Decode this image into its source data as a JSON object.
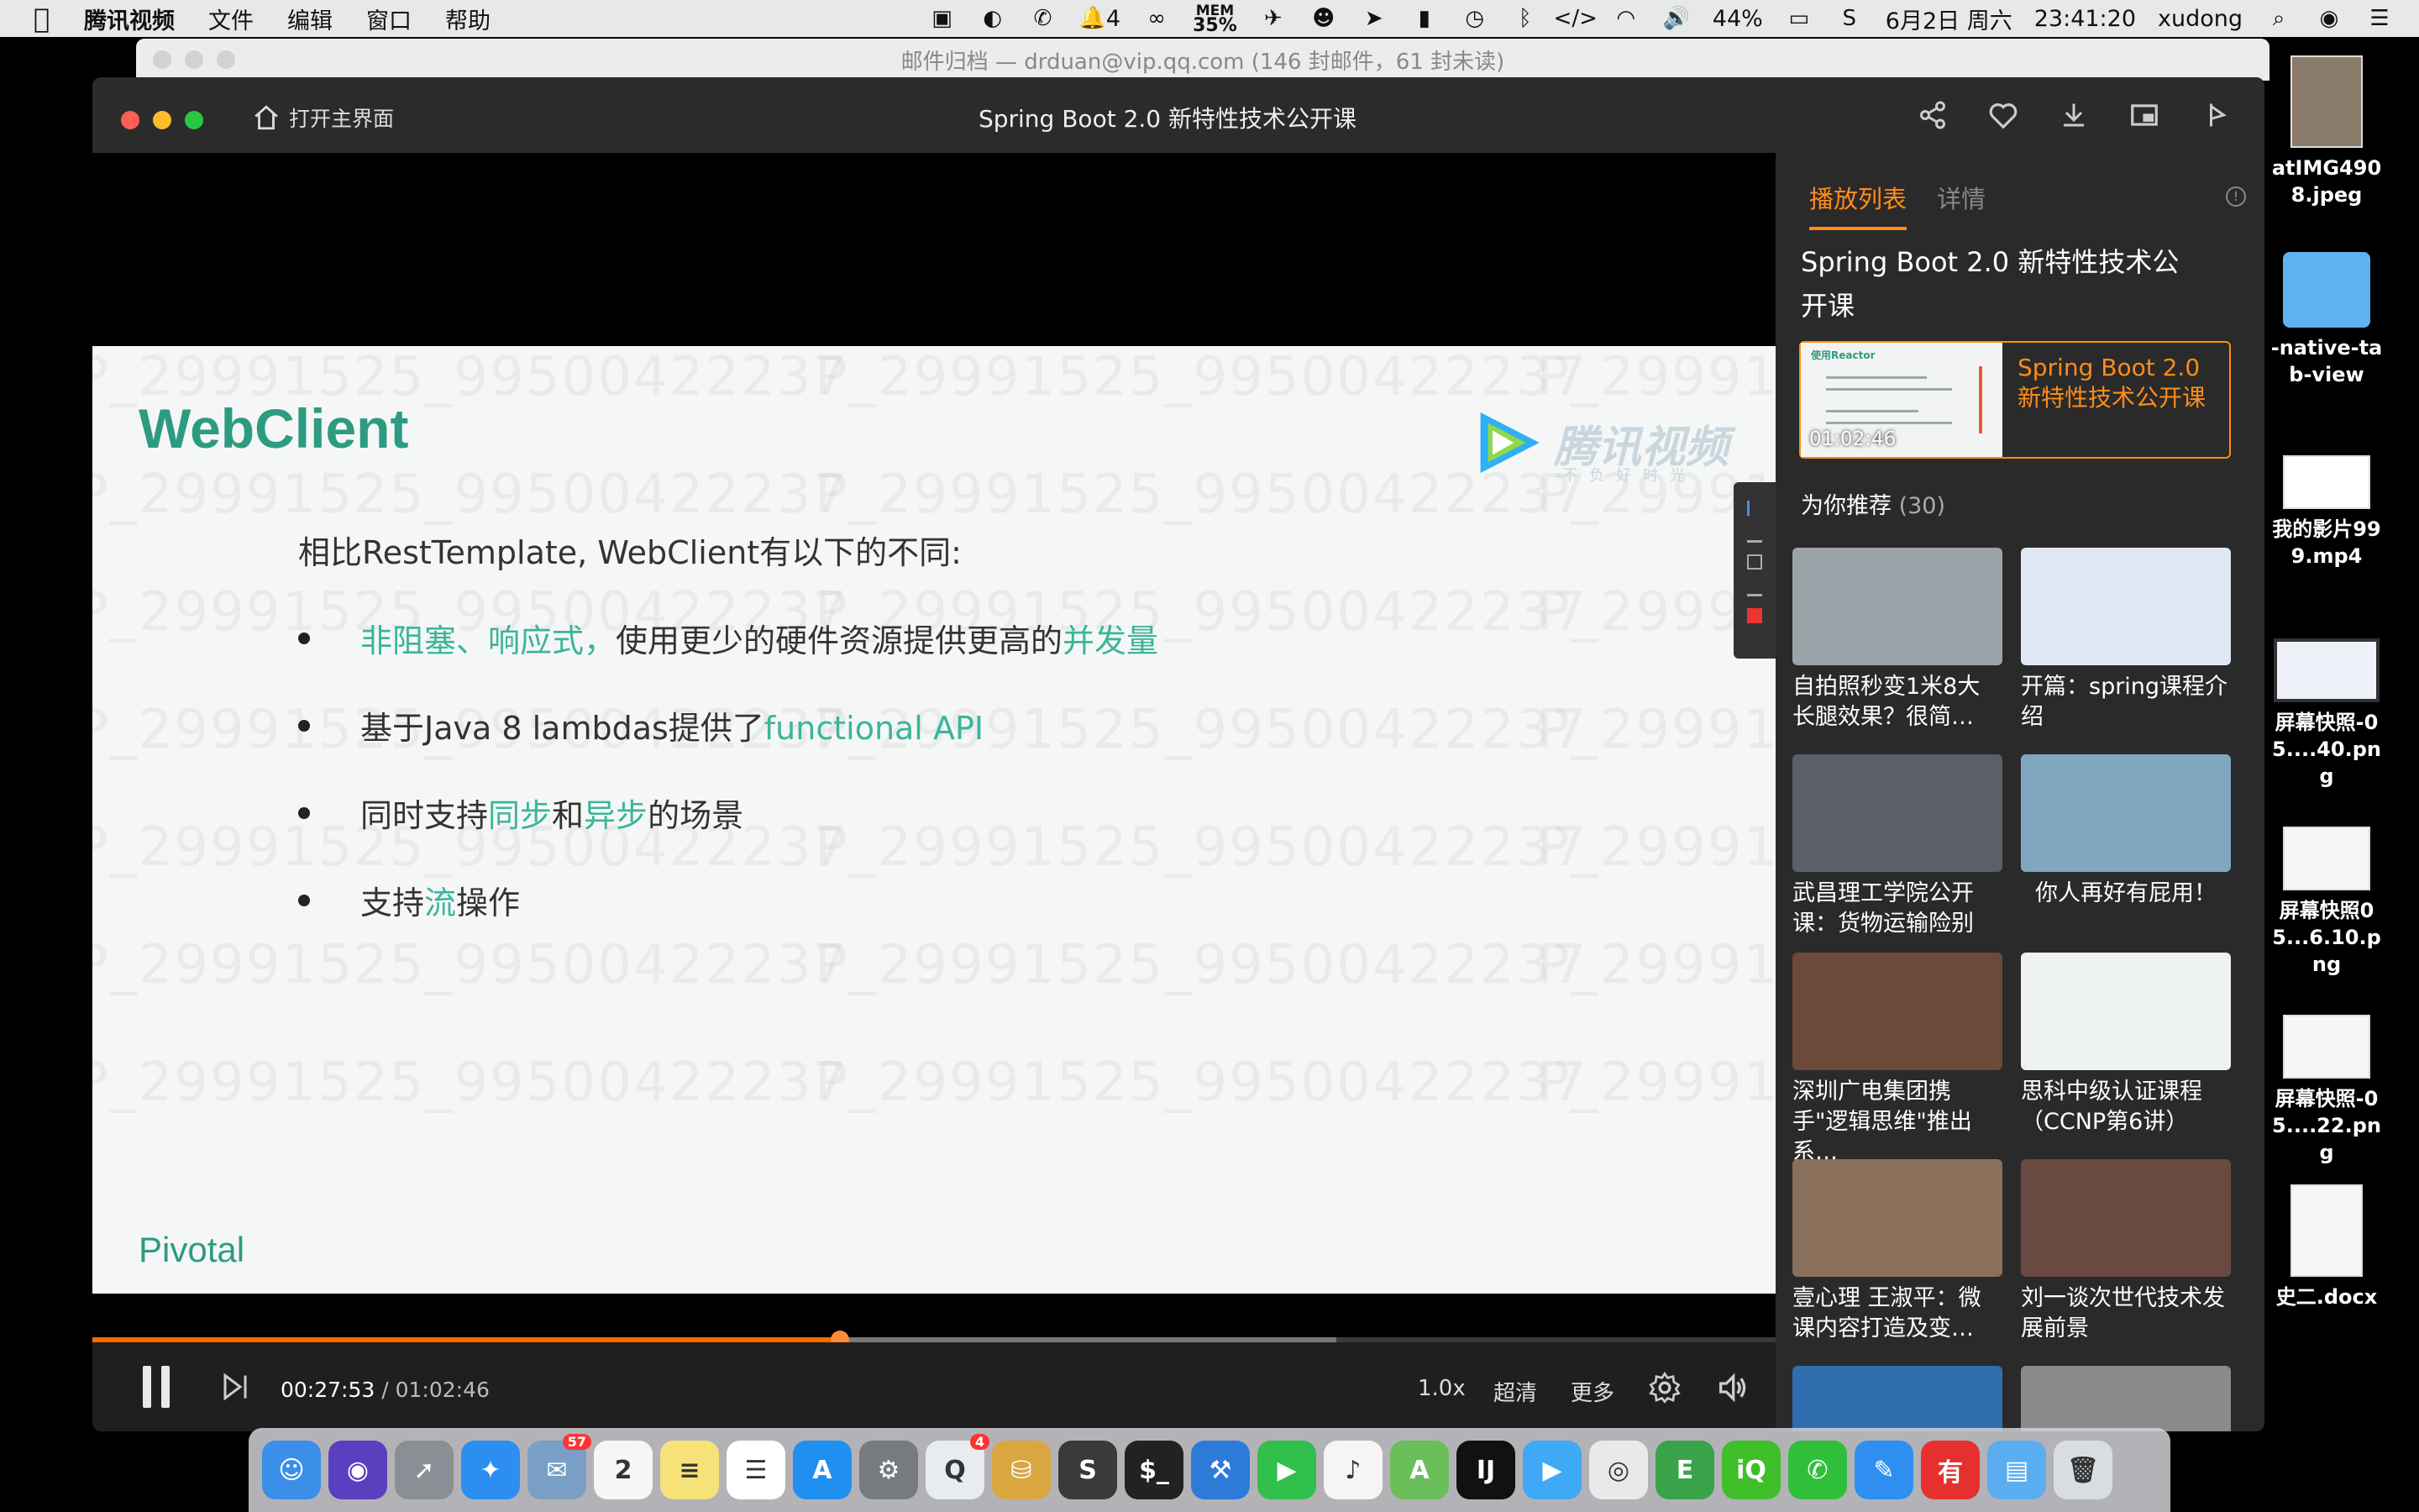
{
  "menubar": {
    "app_name": "腾讯视频",
    "menus": [
      "文件",
      "编辑",
      "窗口",
      "帮助"
    ],
    "notification_count": "4",
    "mem_label": "MEM",
    "mem_value": "35%",
    "battery": "44%",
    "date": "6月2日 周六",
    "time": "23:41:20",
    "user": "xudong"
  },
  "mail_window": {
    "title": "邮件归档 — drduan@vip.qq.com (146 封邮件，61 封未读)"
  },
  "player": {
    "home_label": "打开主界面",
    "title": "Spring Boot 2.0 新特性技术公开课",
    "toolbar_icons": [
      "share-icon",
      "favorite-icon",
      "download-icon",
      "miniplayer-icon",
      "pin-icon"
    ]
  },
  "slide": {
    "title": "WebClient",
    "subtitle": "相比RestTemplate, WebClient有以下的不同:",
    "watermark": "P_29991525_99500422237",
    "bullets": [
      {
        "parts": [
          {
            "t": "非阻塞、响应式，",
            "hl": true
          },
          {
            "t": "使用更少的硬件资源提供更高的",
            "hl": false
          },
          {
            "t": "并发量",
            "hl": true
          }
        ]
      },
      {
        "parts": [
          {
            "t": "基于Java 8 lambdas提供了",
            "hl": false
          },
          {
            "t": "functional API",
            "hl": true
          }
        ]
      },
      {
        "parts": [
          {
            "t": "同时支持",
            "hl": false
          },
          {
            "t": "同步",
            "hl": true
          },
          {
            "t": "和",
            "hl": false
          },
          {
            "t": "异步",
            "hl": true
          },
          {
            "t": "的场景",
            "hl": false
          }
        ]
      },
      {
        "parts": [
          {
            "t": "支持",
            "hl": false
          },
          {
            "t": "流",
            "hl": true
          },
          {
            "t": "操作",
            "hl": false
          }
        ]
      }
    ],
    "footer_logo": "Pivotal",
    "brand_logo": "腾讯视频",
    "brand_sub": "不负好时光"
  },
  "controls": {
    "current_time": "00:27:53",
    "separator": " / ",
    "duration": "01:02:46",
    "progress": 0.444,
    "buffered": 0.739,
    "speed": "1.0x",
    "quality": "超清",
    "more": "更多"
  },
  "panel": {
    "tabs": [
      "播放列表",
      "详情"
    ],
    "active_tab": 0,
    "playlist_title": "Spring Boot 2.0 新特性技术公开课",
    "current_item": {
      "title": "Spring Boot 2.0 新特性技术公开课",
      "duration": "01:02:46",
      "thumb_label": "使用Reactor"
    },
    "recommend_label": "为你推荐",
    "recommend_count": "(30)",
    "recommendations": [
      {
        "title": "自拍照秒变1米8大长腿效果？很简…",
        "color": "#9aa3a8"
      },
      {
        "title": "开篇：spring课程介绍",
        "color": "#dfe7f2"
      },
      {
        "title": "武昌理工学院公开课：货物运输险别",
        "color": "#5a5f6a"
      },
      {
        "title": "你人再好有屁用！",
        "color": "#7fa8c0"
      },
      {
        "title": "深圳广电集团携手\"逻辑思维\"推出系…",
        "color": "#6b4a3a"
      },
      {
        "title": "思科中级认证课程（CCNP第6讲）",
        "color": "#eef2ee"
      },
      {
        "title": "壹心理 王淑平：微课内容打造及变…",
        "color": "#8a6f5a"
      },
      {
        "title": "刘一谈次世代技术发展前景",
        "color": "#6a4a40"
      },
      {
        "title": "",
        "color": "#2f6fb0"
      },
      {
        "title": "",
        "color": "#8a8a8a"
      }
    ]
  },
  "desktop": {
    "items": [
      {
        "label": "atIMG4908.jpeg"
      },
      {
        "label": "-native-tab-view"
      },
      {
        "label": "我的影片999.mp4"
      },
      {
        "label": "屏幕快照-05....40.png"
      },
      {
        "label": "屏幕快照05...6.10.png"
      },
      {
        "label": "屏幕快照-05....22.png"
      },
      {
        "label": "史二.docx"
      }
    ]
  },
  "dock": {
    "apps": [
      {
        "name": "finder-icon",
        "color": "#3b8fe8",
        "glyph": "☺"
      },
      {
        "name": "siri-icon",
        "color": "#5a3fbf",
        "glyph": "◉"
      },
      {
        "name": "launchpad-icon",
        "color": "#8a8f96",
        "glyph": "➚"
      },
      {
        "name": "safari-icon",
        "color": "#2b8ef0",
        "glyph": "✦"
      },
      {
        "name": "mail-icon",
        "color": "#7a9fc4",
        "glyph": "✉",
        "badge": "57"
      },
      {
        "name": "calendar-icon",
        "color": "#f6f6f6",
        "glyph": "2"
      },
      {
        "name": "notes-icon",
        "color": "#f7e27a",
        "glyph": "≡"
      },
      {
        "name": "reminders-icon",
        "color": "#ffffff",
        "glyph": "☰"
      },
      {
        "name": "appstore-icon",
        "color": "#1f8ff0",
        "glyph": "A"
      },
      {
        "name": "system-preferences-icon",
        "color": "#777b80",
        "glyph": "⚙"
      },
      {
        "name": "qq-icon",
        "color": "#e9ecef",
        "glyph": "Q",
        "badge": "4"
      },
      {
        "name": "sequel-icon",
        "color": "#d9a640",
        "glyph": "⛁"
      },
      {
        "name": "sublime-icon",
        "color": "#3a3a3a",
        "glyph": "S"
      },
      {
        "name": "terminal-icon",
        "color": "#222222",
        "glyph": "$_"
      },
      {
        "name": "xcode-icon",
        "color": "#2d7bd8",
        "glyph": "⚒"
      },
      {
        "name": "facetime-icon",
        "color": "#2fbf4a",
        "glyph": "▶"
      },
      {
        "name": "music-icon",
        "color": "#f5f5f5",
        "glyph": "♪"
      },
      {
        "name": "android-studio-icon",
        "color": "#6abf5a",
        "glyph": "A"
      },
      {
        "name": "intellij-icon",
        "color": "#111111",
        "glyph": "IJ"
      },
      {
        "name": "tencent-video-icon",
        "color": "#3fa9f5",
        "glyph": "▶"
      },
      {
        "name": "chrome-icon",
        "color": "#e9e9e9",
        "glyph": "◎"
      },
      {
        "name": "evernote-icon",
        "color": "#3aa34a",
        "glyph": "E"
      },
      {
        "name": "iqiyi-icon",
        "color": "#3fbf2a",
        "glyph": "iQ"
      },
      {
        "name": "wechat-icon",
        "color": "#2fbf3a",
        "glyph": "✆"
      },
      {
        "name": "pages-icon",
        "color": "#2f8ff0",
        "glyph": "✎"
      },
      {
        "name": "youdao-icon",
        "color": "#e63030",
        "glyph": "有"
      },
      {
        "name": "downloads-folder-icon",
        "color": "#5aaef0",
        "glyph": "▤"
      },
      {
        "name": "trash-icon",
        "color": "#d8dde2",
        "glyph": "🗑"
      }
    ]
  }
}
